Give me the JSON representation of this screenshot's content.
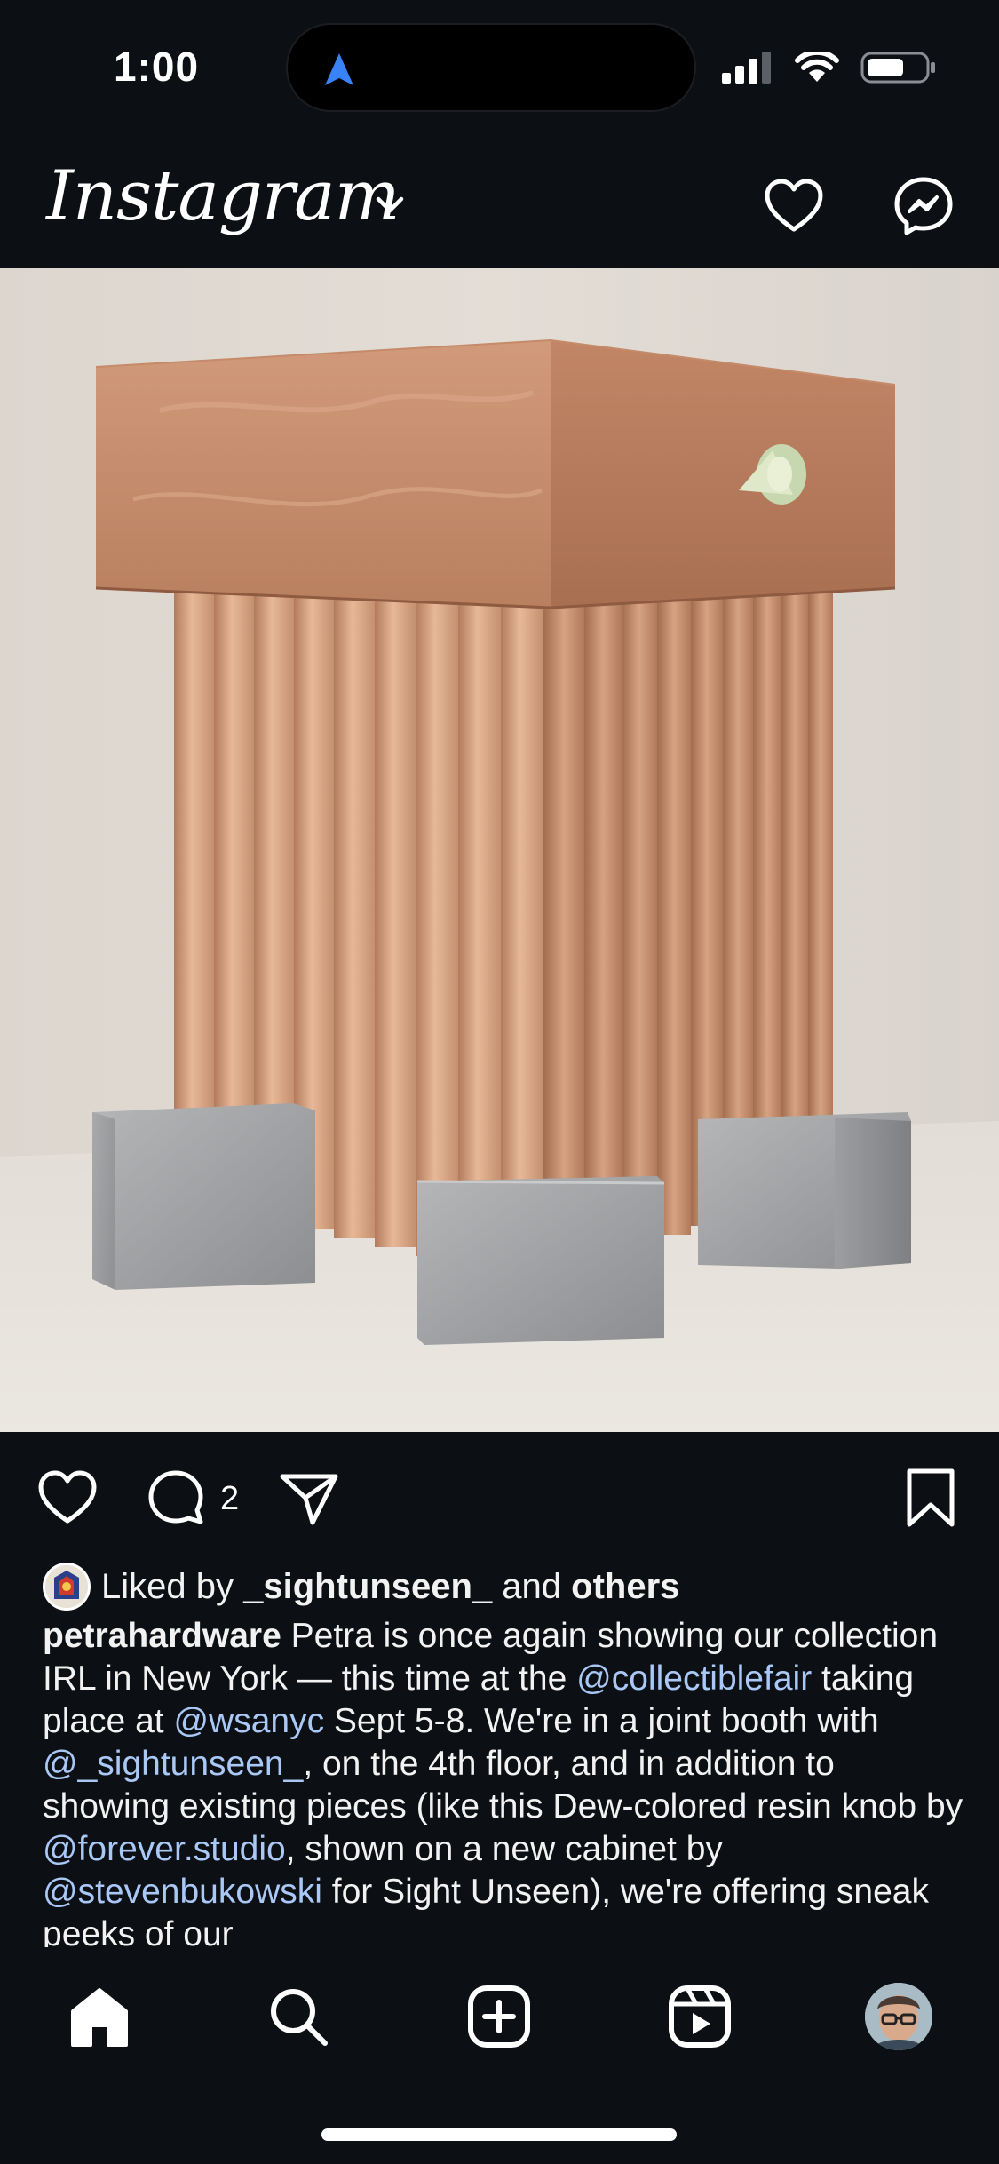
{
  "status_bar": {
    "time": "1:00"
  },
  "header": {
    "logo": "Instagram"
  },
  "post": {
    "comment_count": "2",
    "likes": {
      "prefix": "Liked by ",
      "user": "_sightunseen_",
      "middle": " and ",
      "others": "others"
    },
    "caption": {
      "username": "petrahardware",
      "t1": " Petra is once again showing our collection IRL in New York — this time at the ",
      "m1": "@collectiblefair",
      "t2": " taking place at ",
      "m2": "@wsanyc",
      "t3": " Sept 5-8. We're in a joint booth with ",
      "m3": "@_sightunseen_",
      "t4": ", on the 4th floor, and in addition to showing existing pieces (like this Dew-colored resin knob by ",
      "m4": "@forever.studio",
      "t5": ", shown on a new cabinet by ",
      "m5": "@stevenbukowski",
      "t6": " for Sight Unseen), we're offering sneak peeks of our"
    }
  },
  "icons": {
    "header": [
      "chevron-down-icon",
      "heart-icon",
      "messenger-icon"
    ],
    "actions": [
      "heart-icon",
      "comment-icon",
      "share-icon",
      "bookmark-icon"
    ],
    "nav": [
      "home-icon",
      "search-icon",
      "create-icon",
      "reels-icon",
      "profile-avatar"
    ]
  }
}
